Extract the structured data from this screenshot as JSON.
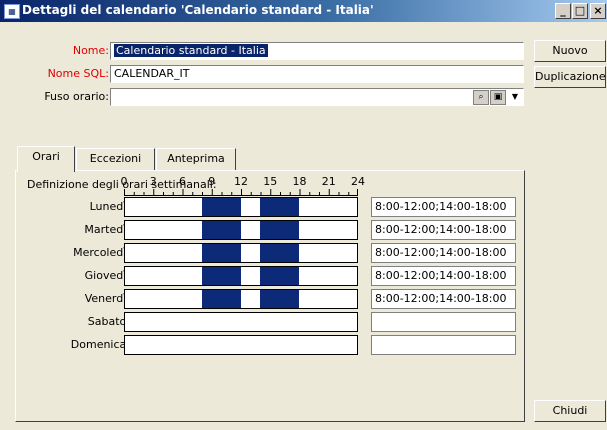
{
  "window": {
    "title": "Dettagli del calendario 'Calendario standard - Italia'",
    "app_icon": "calendar-app-icon",
    "minimize": "_",
    "maximize": "□",
    "close": "×"
  },
  "fields": {
    "nome_label": "Nome:",
    "nome_value": "Calendario standard - Italia",
    "nome_sql_label": "Nome SQL:",
    "nome_sql_value": "CALENDAR_IT",
    "fuso_label": "Fuso orario:",
    "fuso_value": ""
  },
  "buttons": {
    "nuovo": "Nuovo",
    "duplicazione": "Duplicazione",
    "chiudi": "Chiudi"
  },
  "tabs": [
    {
      "label": "Orari",
      "active": true
    },
    {
      "label": "Eccezioni",
      "active": false
    },
    {
      "label": "Anteprima",
      "active": false
    }
  ],
  "schedule": {
    "heading": "Definizione degli orari settimanali:",
    "hour_ticks": [
      "0",
      "3",
      "6",
      "9",
      "12",
      "15",
      "18",
      "21",
      "24"
    ],
    "days": [
      {
        "label": "Lunedì",
        "hours": "8:00-12:00;14:00-18:00",
        "blocks": [
          [
            8,
            12
          ],
          [
            14,
            18
          ]
        ]
      },
      {
        "label": "Martedì",
        "hours": "8:00-12:00;14:00-18:00",
        "blocks": [
          [
            8,
            12
          ],
          [
            14,
            18
          ]
        ]
      },
      {
        "label": "Mercoledì",
        "hours": "8:00-12:00;14:00-18:00",
        "blocks": [
          [
            8,
            12
          ],
          [
            14,
            18
          ]
        ]
      },
      {
        "label": "Giovedì",
        "hours": "8:00-12:00;14:00-18:00",
        "blocks": [
          [
            8,
            12
          ],
          [
            14,
            18
          ]
        ]
      },
      {
        "label": "Venerdì",
        "hours": "8:00-12:00;14:00-18:00",
        "blocks": [
          [
            8,
            12
          ],
          [
            14,
            18
          ]
        ]
      },
      {
        "label": "Sabato",
        "hours": "",
        "blocks": []
      },
      {
        "label": "Domenica",
        "hours": "",
        "blocks": []
      }
    ]
  },
  "colors": {
    "title_gradient_start": "#0a246a",
    "required_label": "#e10000",
    "schedule_block": "#0c2a77",
    "face": "#ece9d8"
  }
}
